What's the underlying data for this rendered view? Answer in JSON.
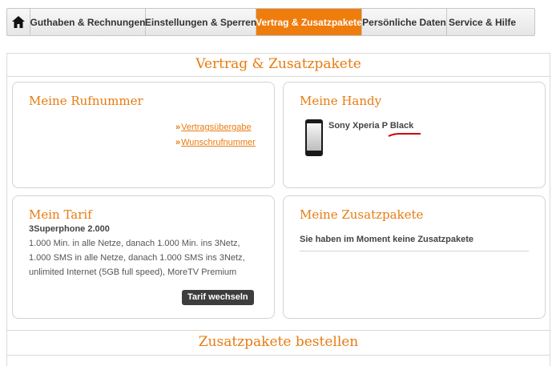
{
  "nav": {
    "home_icon": "home-icon",
    "tabs": [
      {
        "label": "Guthaben & Rechnungen",
        "active": false
      },
      {
        "label": "Einstellungen & Sperren",
        "active": false
      },
      {
        "label": "Vertrag & Zusatzpakete",
        "active": true
      },
      {
        "label": "Persönliche Daten",
        "active": false
      },
      {
        "label": "Service & Hilfe",
        "active": false
      }
    ]
  },
  "main": {
    "title": "Vertrag & Zusatzpakete",
    "rufnummer": {
      "title": "Meine Rufnummer",
      "links": [
        "Vertragsübergabe",
        "Wunschrufnummer"
      ]
    },
    "handy": {
      "title": "Meine Handy",
      "device_name": "Sony Xperia P Black"
    },
    "tarif": {
      "title": "Mein Tarif",
      "name": "3Superphone 2.000",
      "lines": [
        "1.000 Min. in alle Netze, danach 1.000 Min. ins 3Netz,",
        "1.000 SMS in alle Netze, danach 1.000 SMS ins 3Netz,",
        "unlimited Internet (5GB full speed), MoreTV Premium"
      ],
      "button": "Tarif wechseln"
    },
    "zusatzpakete": {
      "title": "Meine Zusatzpakete",
      "message": "Sie haben im Moment keine Zusatzpakete"
    },
    "order_title": "Zusatzpakete bestellen"
  },
  "colors": {
    "accent": "#ef7d0d",
    "accent_text": "#e87b10",
    "annotation": "#cc0000"
  }
}
